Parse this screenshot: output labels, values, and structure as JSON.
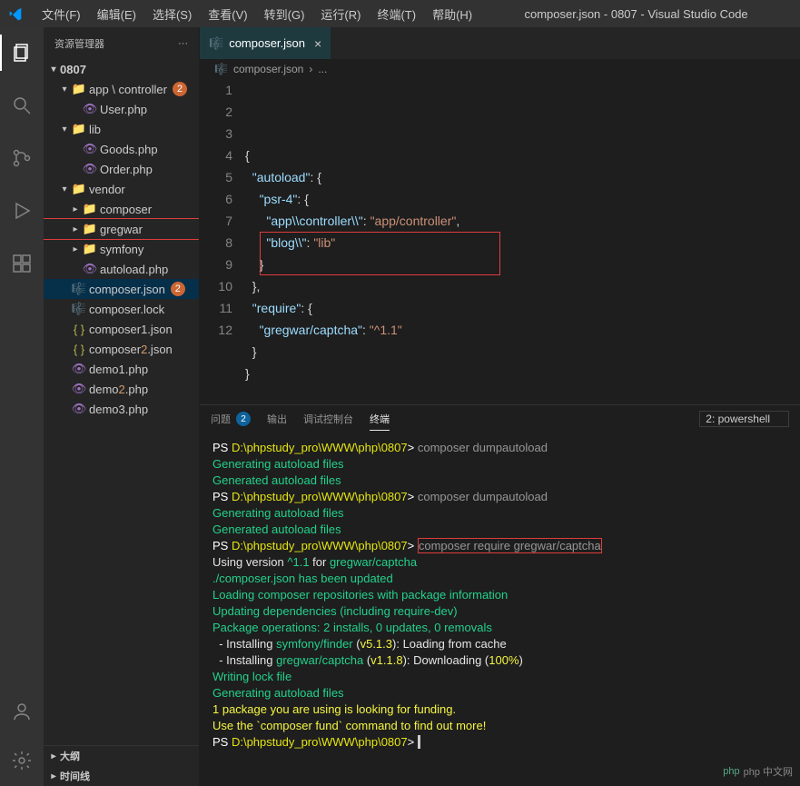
{
  "window": {
    "title": "composer.json - 0807 - Visual Studio Code"
  },
  "menu": [
    "文件(F)",
    "编辑(E)",
    "选择(S)",
    "查看(V)",
    "转到(G)",
    "运行(R)",
    "终端(T)",
    "帮助(H)"
  ],
  "explorer": {
    "title": "资源管理器",
    "root": "0807",
    "tree": [
      {
        "type": "folder",
        "label": "app \\ controller",
        "depth": 1,
        "open": true,
        "badge": "2"
      },
      {
        "type": "file",
        "label": "User.php",
        "depth": 2,
        "icon": "php"
      },
      {
        "type": "folder",
        "label": "lib",
        "depth": 1,
        "open": true
      },
      {
        "type": "file",
        "label": "Goods.php",
        "depth": 2,
        "icon": "php"
      },
      {
        "type": "file",
        "label": "Order.php",
        "depth": 2,
        "icon": "php"
      },
      {
        "type": "folder",
        "label": "vendor",
        "depth": 1,
        "open": true
      },
      {
        "type": "folder",
        "label": "composer",
        "depth": 2,
        "open": false
      },
      {
        "type": "folder",
        "label": "gregwar",
        "depth": 2,
        "open": false,
        "boxed": true
      },
      {
        "type": "folder",
        "label": "symfony",
        "depth": 2,
        "open": false
      },
      {
        "type": "file",
        "label": "autoload.php",
        "depth": 2,
        "icon": "php"
      },
      {
        "type": "file",
        "label": "composer.json",
        "depth": 1,
        "icon": "composer",
        "selected": true,
        "badge": "2",
        "modified": true
      },
      {
        "type": "file",
        "label": "composer.lock",
        "depth": 1,
        "icon": "composer"
      },
      {
        "type": "file",
        "label": "composer1.json",
        "depth": 1,
        "icon": "json"
      },
      {
        "type": "file",
        "label": "composer2.json",
        "depth": 1,
        "icon": "json",
        "modified": true
      },
      {
        "type": "file",
        "label": "demo1.php",
        "depth": 1,
        "icon": "php"
      },
      {
        "type": "file",
        "label": "demo2.php",
        "depth": 1,
        "icon": "php",
        "modified": true
      },
      {
        "type": "file",
        "label": "demo3.php",
        "depth": 1,
        "icon": "php"
      }
    ],
    "outline": "大纲",
    "timeline": "时间线"
  },
  "tab": {
    "label": "composer.json"
  },
  "breadcrumb": {
    "file": "composer.json",
    "more": "..."
  },
  "code": {
    "lines": [
      [
        [
          "punc",
          "{"
        ]
      ],
      [
        [
          "punc",
          "  "
        ],
        [
          "key",
          "\"autoload\""
        ],
        [
          "punc",
          ": "
        ],
        [
          "punc",
          "{"
        ]
      ],
      [
        [
          "punc",
          "    "
        ],
        [
          "key",
          "\"psr-4\""
        ],
        [
          "punc",
          ": "
        ],
        [
          "punc",
          "{"
        ]
      ],
      [
        [
          "punc",
          "      "
        ],
        [
          "key",
          "\"app\\\\controller\\\\\""
        ],
        [
          "punc",
          ": "
        ],
        [
          "str",
          "\"app/controller\""
        ],
        [
          "punc",
          ","
        ]
      ],
      [
        [
          "punc",
          "      "
        ],
        [
          "key",
          "\"blog\\\\\""
        ],
        [
          "punc",
          ": "
        ],
        [
          "str",
          "\"lib\""
        ]
      ],
      [
        [
          "punc",
          "    "
        ],
        [
          "punc",
          "}"
        ]
      ],
      [
        [
          "punc",
          "  "
        ],
        [
          "punc",
          "},"
        ]
      ],
      [
        [
          "punc",
          "  "
        ],
        [
          "key",
          "\"require\""
        ],
        [
          "punc",
          ": "
        ],
        [
          "punc",
          "{"
        ]
      ],
      [
        [
          "punc",
          "    "
        ],
        [
          "key",
          "\"gregwar/captcha\""
        ],
        [
          "punc",
          ": "
        ],
        [
          "str",
          "\"^1.1\""
        ]
      ],
      [
        [
          "punc",
          "  "
        ],
        [
          "punc",
          "}"
        ]
      ],
      [
        [
          "punc",
          "}"
        ]
      ],
      []
    ]
  },
  "panel": {
    "tabs": {
      "problems": "问题",
      "problems_count": "2",
      "output": "输出",
      "debug": "调试控制台",
      "terminal": "终端"
    },
    "terminal_selector": "2: powershell"
  },
  "terminal": {
    "prompt_prefix": "PS ",
    "path": "D:\\phpstudy_pro\\WWW\\php\\0807",
    "lines": [
      {
        "type": "prompt",
        "cmd": "composer dumpautoload"
      },
      {
        "type": "green",
        "text": "Generating autoload files"
      },
      {
        "type": "green",
        "text": "Generated autoload files"
      },
      {
        "type": "prompt",
        "cmd": "composer dumpautoload"
      },
      {
        "type": "green",
        "text": "Generating autoload files"
      },
      {
        "type": "green",
        "text": "Generated autoload files"
      },
      {
        "type": "prompt-boxed",
        "cmd": "composer require gregwar/captcha"
      },
      {
        "type": "mixed",
        "segments": [
          [
            "white",
            "Using version "
          ],
          [
            "green",
            "^1.1"
          ],
          [
            "white",
            " for "
          ],
          [
            "green",
            "gregwar/captcha"
          ]
        ]
      },
      {
        "type": "green",
        "text": "./composer.json has been updated"
      },
      {
        "type": "green",
        "text": "Loading composer repositories with package information"
      },
      {
        "type": "green",
        "text": "Updating dependencies (including require-dev)"
      },
      {
        "type": "green",
        "text": "Package operations: 2 installs, 0 updates, 0 removals"
      },
      {
        "type": "mixed",
        "segments": [
          [
            "white",
            "  - Installing "
          ],
          [
            "green",
            "symfony/finder"
          ],
          [
            "white",
            " ("
          ],
          [
            "yellow",
            "v5.1.3"
          ],
          [
            "white",
            "): Loading from cache"
          ]
        ]
      },
      {
        "type": "mixed",
        "segments": [
          [
            "white",
            "  - Installing "
          ],
          [
            "green",
            "gregwar/captcha"
          ],
          [
            "white",
            " ("
          ],
          [
            "yellow",
            "v1.1.8"
          ],
          [
            "white",
            "): Downloading ("
          ],
          [
            "yellow",
            "100%"
          ],
          [
            "white",
            ")"
          ]
        ]
      },
      {
        "type": "green",
        "text": "Writing lock file"
      },
      {
        "type": "green",
        "text": "Generating autoload files"
      },
      {
        "type": "yellow",
        "text": "1 package you are using is looking for funding."
      },
      {
        "type": "yellow",
        "text": "Use the `composer fund` command to find out more!"
      },
      {
        "type": "prompt",
        "cmd": ""
      }
    ]
  },
  "watermark": "php 中文网"
}
